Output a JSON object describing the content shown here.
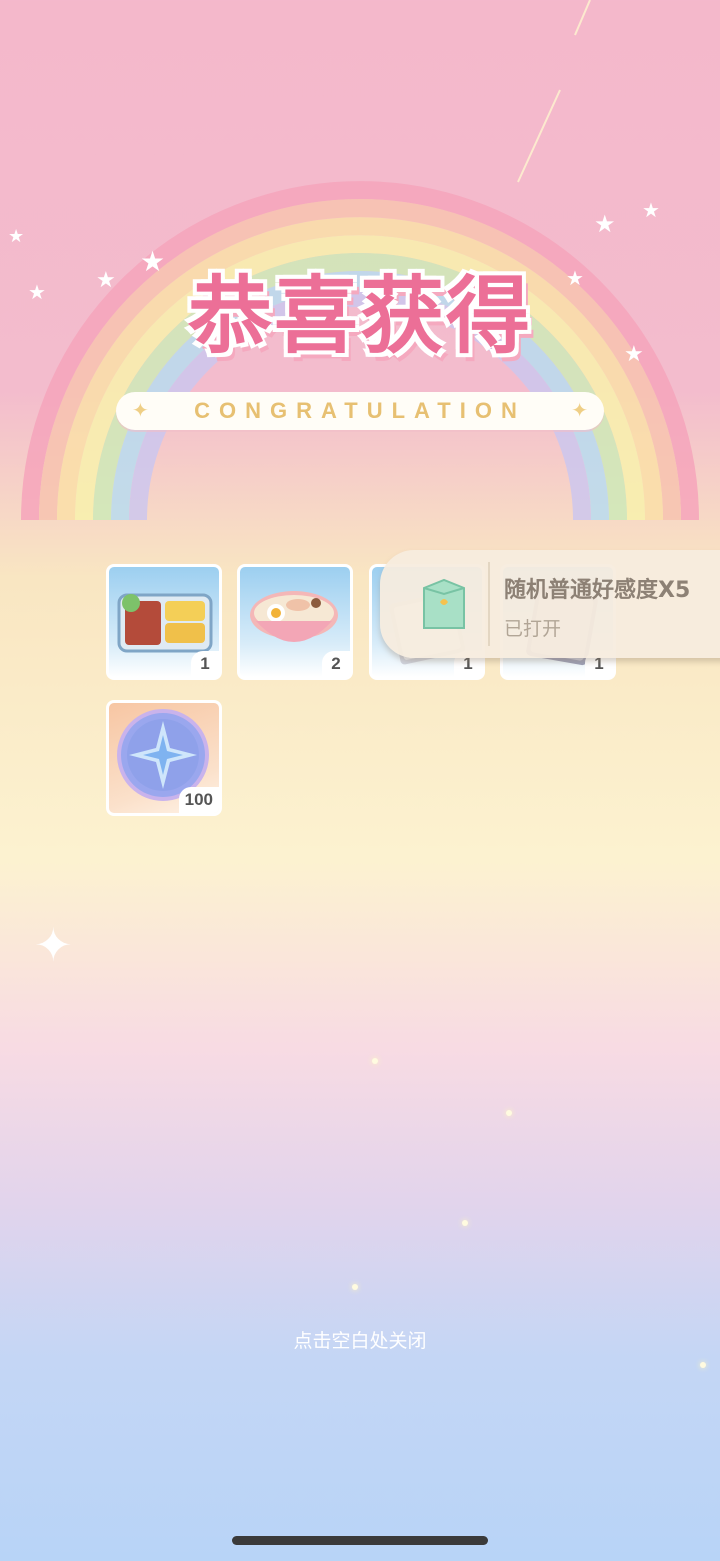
{
  "header": {
    "title": "恭喜获得",
    "subtitle": "CONGRATULATION"
  },
  "rewards": [
    {
      "icon": "bento-box-icon",
      "qty": "1"
    },
    {
      "icon": "ramen-bowl-icon",
      "qty": "2"
    },
    {
      "icon": "book-icon",
      "qty": "1"
    },
    {
      "icon": "notebook-icon",
      "qty": "1"
    },
    {
      "icon": "star-coin-icon",
      "qty": "100"
    }
  ],
  "popup": {
    "name": "随机普通好感度X5",
    "status": "已打开",
    "icon": "gift-bag-icon"
  },
  "footer": {
    "close_hint": "点击空白处关闭"
  },
  "colors": {
    "title_pink": "#ec6f97",
    "subtitle_gold": "#e7c072",
    "popup_bg": "#f6ecde"
  }
}
